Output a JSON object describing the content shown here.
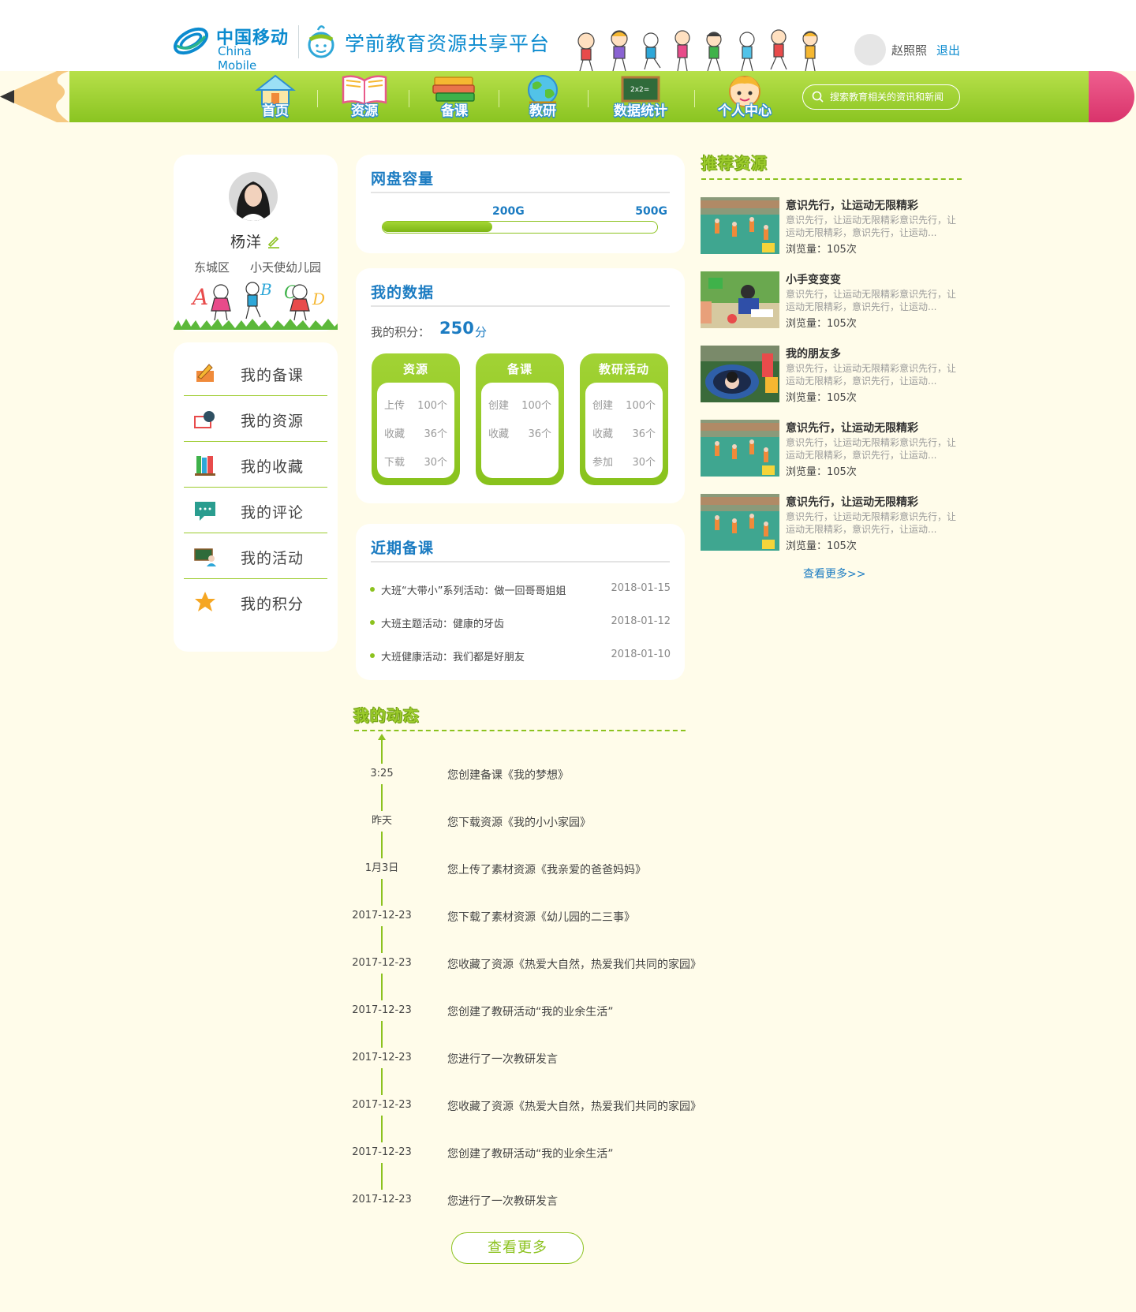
{
  "header": {
    "brand_cn": "中国移动",
    "brand_en": "China Mobile",
    "platform_title": "学前教育资源共享平台",
    "username": "赵照照",
    "logout_label": "退出"
  },
  "nav": {
    "items": [
      {
        "label": "首页",
        "icon": "house-icon"
      },
      {
        "label": "资源",
        "icon": "book-icon"
      },
      {
        "label": "备课",
        "icon": "books-stack-icon"
      },
      {
        "label": "教研",
        "icon": "globe-icon"
      },
      {
        "label": "数据统计",
        "icon": "chalkboard-icon"
      },
      {
        "label": "个人中心",
        "icon": "child-face-icon"
      }
    ],
    "search_placeholder": "搜索教育相关的资讯和新闻"
  },
  "profile": {
    "name": "杨洋",
    "district": "东城区",
    "school": "小天使幼儿园"
  },
  "menu": {
    "items": [
      {
        "label": "我的备课",
        "icon": "pencil-book-icon"
      },
      {
        "label": "我的资源",
        "icon": "book-magnifier-icon"
      },
      {
        "label": "我的收藏",
        "icon": "bookshelf-icon"
      },
      {
        "label": "我的评论",
        "icon": "chat-bubble-icon"
      },
      {
        "label": "我的活动",
        "icon": "teacher-board-icon"
      },
      {
        "label": "我的积分",
        "icon": "star-icon"
      }
    ]
  },
  "disk": {
    "title": "网盘容量",
    "used_label": "200G",
    "total_label": "500G",
    "used_fraction": 0.4
  },
  "mydata": {
    "title": "我的数据",
    "score_label": "我的积分：",
    "score_value": "250",
    "score_unit": "分",
    "stats": [
      {
        "title": "资源",
        "rows": [
          {
            "k": "上传",
            "v": "100个"
          },
          {
            "k": "收藏",
            "v": "36个"
          },
          {
            "k": "下载",
            "v": "30个"
          }
        ]
      },
      {
        "title": "备课",
        "rows": [
          {
            "k": "创建",
            "v": "100个"
          },
          {
            "k": "收藏",
            "v": "36个"
          }
        ]
      },
      {
        "title": "教研活动",
        "rows": [
          {
            "k": "创建",
            "v": "100个"
          },
          {
            "k": "收藏",
            "v": "36个"
          },
          {
            "k": "参加",
            "v": "30个"
          }
        ]
      }
    ]
  },
  "recent": {
    "title": "近期备课",
    "items": [
      {
        "text": "大班“大带小”系列活动：做一回哥哥姐姐",
        "date": "2018-01-15"
      },
      {
        "text": "大班主题活动：健康的牙齿",
        "date": "2018-01-12"
      },
      {
        "text": "大班健康活动：我们都是好朋友",
        "date": "2018-01-10"
      }
    ]
  },
  "dynamic": {
    "title": "我的动态",
    "items": [
      {
        "time": "3:25",
        "text": "您创建备课《我的梦想》"
      },
      {
        "time": "昨天",
        "text": "您下载资源《我的小小家园》"
      },
      {
        "time": "1月3日",
        "text": "您上传了素材资源《我亲爱的爸爸妈妈》"
      },
      {
        "time": "2017-12-23",
        "text": "您下载了素材资源《幼儿园的二三事》"
      },
      {
        "time": "2017-12-23",
        "text": "您收藏了资源《热爱大自然，热爱我们共同的家园》"
      },
      {
        "time": "2017-12-23",
        "text": "您创建了教研活动“我的业余生活”"
      },
      {
        "time": "2017-12-23",
        "text": "您进行了一次教研发言"
      },
      {
        "time": "2017-12-23",
        "text": "您收藏了资源《热爱大自然，热爱我们共同的家园》"
      },
      {
        "time": "2017-12-23",
        "text": "您创建了教研活动“我的业余生活”"
      },
      {
        "time": "2017-12-23",
        "text": "您进行了一次教研发言"
      }
    ],
    "more_label": "查看更多"
  },
  "recommend": {
    "title": "推荐资源",
    "items": [
      {
        "title": "意识先行，让运动无限精彩",
        "desc": "意识先行，让运动无限精彩意识先行，让运动无限精彩，意识先行，让运动...",
        "views": "浏览量：105次",
        "scene": "playground"
      },
      {
        "title": "小手变变变",
        "desc": "意识先行，让运动无限精彩意识先行，让运动无限精彩，意识先行，让运动...",
        "views": "浏览量：105次",
        "scene": "classroom"
      },
      {
        "title": "我的朋友多",
        "desc": "意识先行，让运动无限精彩意识先行，让运动无限精彩，意识先行，让运动...",
        "views": "浏览量：105次",
        "scene": "tunnel"
      },
      {
        "title": "意识先行，让运动无限精彩",
        "desc": "意识先行，让运动无限精彩意识先行，让运动无限精彩，意识先行，让运动...",
        "views": "浏览量：105次",
        "scene": "playground"
      },
      {
        "title": "意识先行，让运动无限精彩",
        "desc": "意识先行，让运动无限精彩意识先行，让运动无限精彩，意识先行，让运动...",
        "views": "浏览量：105次",
        "scene": "playground"
      }
    ],
    "more_label": "查看更多>>"
  }
}
